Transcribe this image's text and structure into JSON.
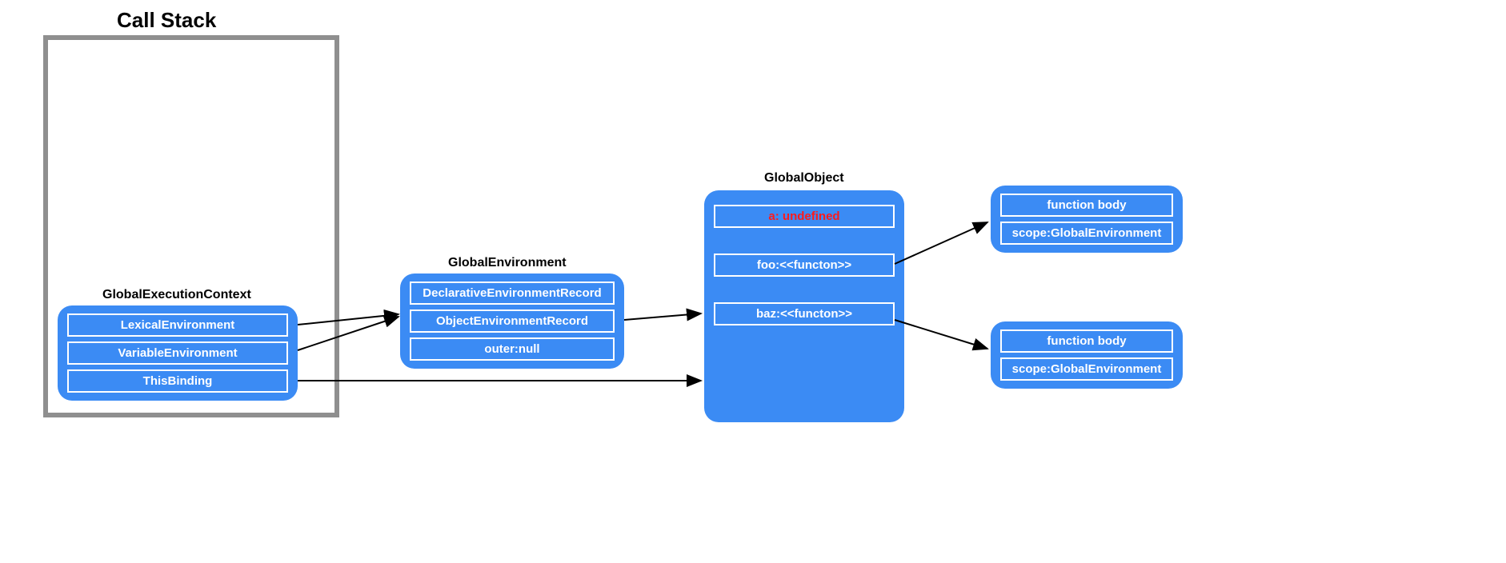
{
  "title": "Call Stack",
  "headings": {
    "gec": "GlobalExecutionContext",
    "ge": "GlobalEnvironment",
    "go": "GlobalObject"
  },
  "gec": {
    "lex": "LexicalEnvironment",
    "var": "VariableEnvironment",
    "this": "ThisBinding"
  },
  "ge": {
    "der": "DeclarativeEnvironmentRecord",
    "oer": "ObjectEnvironmentRecord",
    "outer": "outer:null"
  },
  "go": {
    "a": "a: undefined",
    "foo": "foo:<<functon>>",
    "baz": "baz:<<functon>>"
  },
  "fn1": {
    "body": "function body",
    "scope": "scope:GlobalEnvironment"
  },
  "fn2": {
    "body": "function body",
    "scope": "scope:GlobalEnvironment"
  }
}
